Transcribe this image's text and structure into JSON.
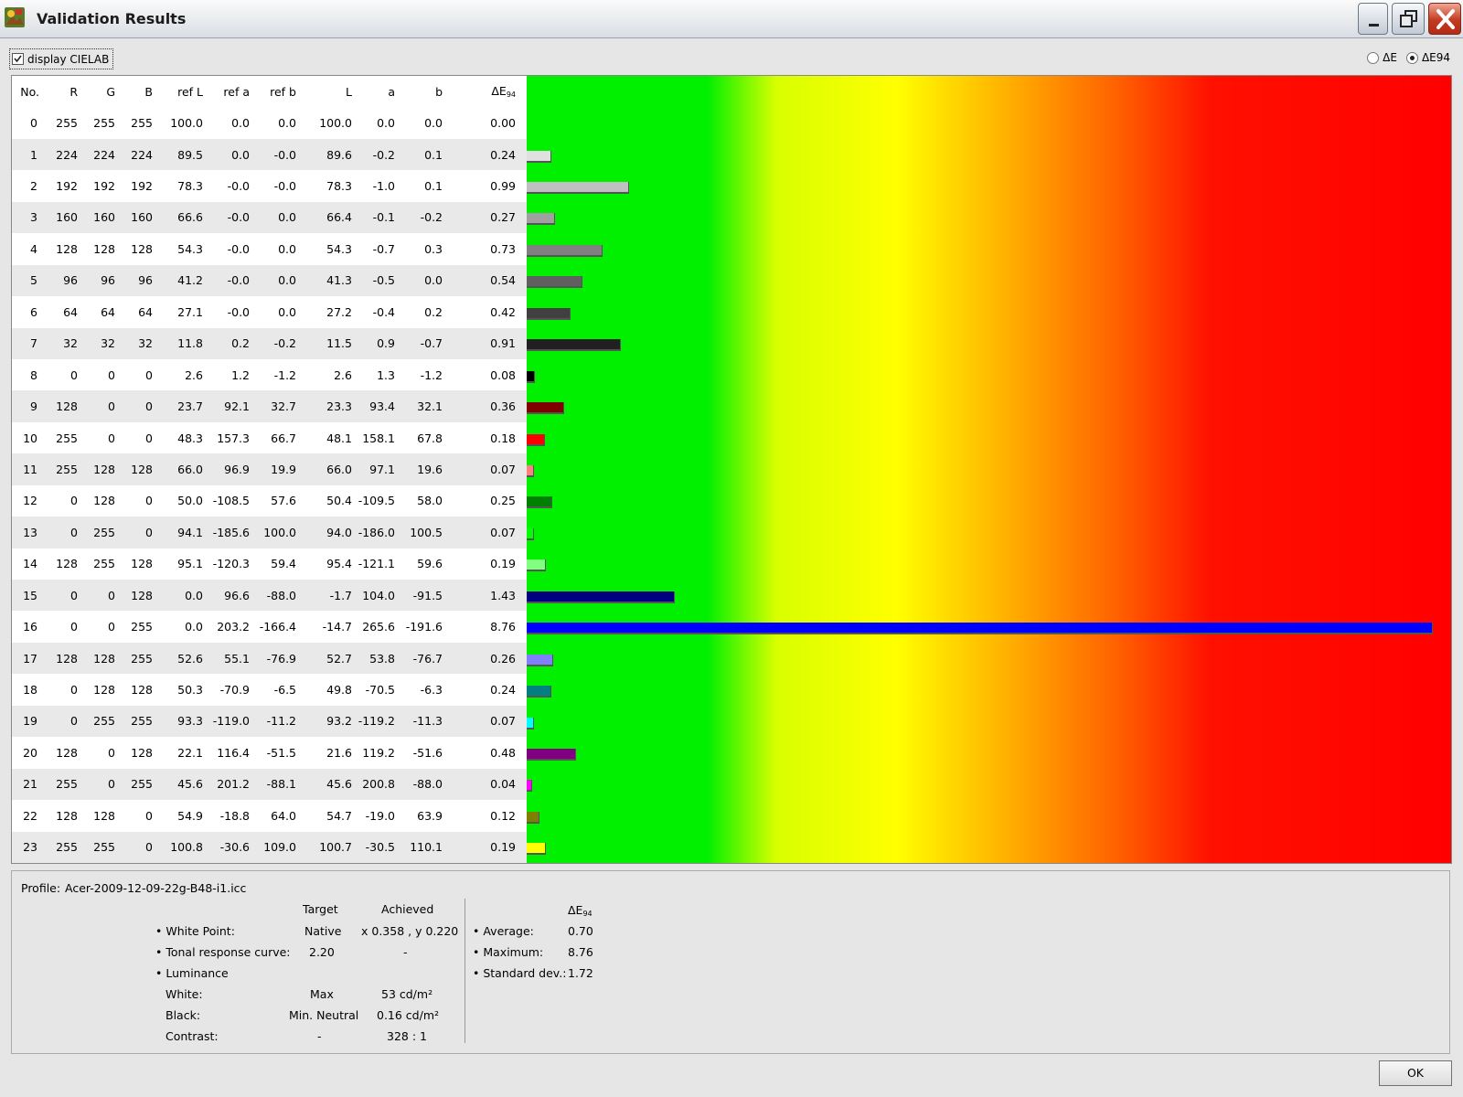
{
  "window": {
    "title": "Validation Results"
  },
  "options": {
    "display_cielab_label": "display CIELAB",
    "display_cielab_checked": true,
    "radio_de_label": "ΔE",
    "radio_de94_label": "ΔE94",
    "radio_selected": "ΔE94"
  },
  "table": {
    "headers": [
      "No.",
      "R",
      "G",
      "B",
      "ref L",
      "ref a",
      "ref b",
      "L",
      "a",
      "b",
      "ΔE",
      "94"
    ],
    "max_delta_scale": 8.76,
    "rows": [
      {
        "no": "0",
        "r": "255",
        "g": "255",
        "b": "255",
        "refL": "100.0",
        "refa": "0.0",
        "refb": "0.0",
        "L": "100.0",
        "a": "0.0",
        "bb": "0.0",
        "de": "0.00",
        "color": "#ffffff",
        "value": 0.0
      },
      {
        "no": "1",
        "r": "224",
        "g": "224",
        "b": "224",
        "refL": "89.5",
        "refa": "0.0",
        "refb": "-0.0",
        "L": "89.6",
        "a": "-0.2",
        "bb": "0.1",
        "de": "0.24",
        "color": "#e0e0e0",
        "value": 0.24
      },
      {
        "no": "2",
        "r": "192",
        "g": "192",
        "b": "192",
        "refL": "78.3",
        "refa": "-0.0",
        "refb": "-0.0",
        "L": "78.3",
        "a": "-1.0",
        "bb": "0.1",
        "de": "0.99",
        "color": "#c0c0c0",
        "value": 0.99
      },
      {
        "no": "3",
        "r": "160",
        "g": "160",
        "b": "160",
        "refL": "66.6",
        "refa": "-0.0",
        "refb": "0.0",
        "L": "66.4",
        "a": "-0.1",
        "bb": "-0.2",
        "de": "0.27",
        "color": "#a0a0a0",
        "value": 0.27
      },
      {
        "no": "4",
        "r": "128",
        "g": "128",
        "b": "128",
        "refL": "54.3",
        "refa": "-0.0",
        "refb": "0.0",
        "L": "54.3",
        "a": "-0.7",
        "bb": "0.3",
        "de": "0.73",
        "color": "#808080",
        "value": 0.73
      },
      {
        "no": "5",
        "r": "96",
        "g": "96",
        "b": "96",
        "refL": "41.2",
        "refa": "-0.0",
        "refb": "0.0",
        "L": "41.3",
        "a": "-0.5",
        "bb": "0.0",
        "de": "0.54",
        "color": "#606060",
        "value": 0.54
      },
      {
        "no": "6",
        "r": "64",
        "g": "64",
        "b": "64",
        "refL": "27.1",
        "refa": "-0.0",
        "refb": "0.0",
        "L": "27.2",
        "a": "-0.4",
        "bb": "0.2",
        "de": "0.42",
        "color": "#404040",
        "value": 0.42
      },
      {
        "no": "7",
        "r": "32",
        "g": "32",
        "b": "32",
        "refL": "11.8",
        "refa": "0.2",
        "refb": "-0.2",
        "L": "11.5",
        "a": "0.9",
        "bb": "-0.7",
        "de": "0.91",
        "color": "#202020",
        "value": 0.91
      },
      {
        "no": "8",
        "r": "0",
        "g": "0",
        "b": "0",
        "refL": "2.6",
        "refa": "1.2",
        "refb": "-1.2",
        "L": "2.6",
        "a": "1.3",
        "bb": "-1.2",
        "de": "0.08",
        "color": "#000000",
        "value": 0.08
      },
      {
        "no": "9",
        "r": "128",
        "g": "0",
        "b": "0",
        "refL": "23.7",
        "refa": "92.1",
        "refb": "32.7",
        "L": "23.3",
        "a": "93.4",
        "bb": "32.1",
        "de": "0.36",
        "color": "#800000",
        "value": 0.36
      },
      {
        "no": "10",
        "r": "255",
        "g": "0",
        "b": "0",
        "refL": "48.3",
        "refa": "157.3",
        "refb": "66.7",
        "L": "48.1",
        "a": "158.1",
        "bb": "67.8",
        "de": "0.18",
        "color": "#ff0000",
        "value": 0.18
      },
      {
        "no": "11",
        "r": "255",
        "g": "128",
        "b": "128",
        "refL": "66.0",
        "refa": "96.9",
        "refb": "19.9",
        "L": "66.0",
        "a": "97.1",
        "bb": "19.6",
        "de": "0.07",
        "color": "#ff8080",
        "value": 0.07
      },
      {
        "no": "12",
        "r": "0",
        "g": "128",
        "b": "0",
        "refL": "50.0",
        "refa": "-108.5",
        "refb": "57.6",
        "L": "50.4",
        "a": "-109.5",
        "bb": "58.0",
        "de": "0.25",
        "color": "#008000",
        "value": 0.25
      },
      {
        "no": "13",
        "r": "0",
        "g": "255",
        "b": "0",
        "refL": "94.1",
        "refa": "-185.6",
        "refb": "100.0",
        "L": "94.0",
        "a": "-186.0",
        "bb": "100.5",
        "de": "0.07",
        "color": "#00ff00",
        "value": 0.07
      },
      {
        "no": "14",
        "r": "128",
        "g": "255",
        "b": "128",
        "refL": "95.1",
        "refa": "-120.3",
        "refb": "59.4",
        "L": "95.4",
        "a": "-121.1",
        "bb": "59.6",
        "de": "0.19",
        "color": "#80ff80",
        "value": 0.19
      },
      {
        "no": "15",
        "r": "0",
        "g": "0",
        "b": "128",
        "refL": "0.0",
        "refa": "96.6",
        "refb": "-88.0",
        "L": "-1.7",
        "a": "104.0",
        "bb": "-91.5",
        "de": "1.43",
        "color": "#000080",
        "value": 1.43
      },
      {
        "no": "16",
        "r": "0",
        "g": "0",
        "b": "255",
        "refL": "0.0",
        "refa": "203.2",
        "refb": "-166.4",
        "L": "-14.7",
        "a": "265.6",
        "bb": "-191.6",
        "de": "8.76",
        "color": "#0000ff",
        "value": 8.76
      },
      {
        "no": "17",
        "r": "128",
        "g": "128",
        "b": "255",
        "refL": "52.6",
        "refa": "55.1",
        "refb": "-76.9",
        "L": "52.7",
        "a": "53.8",
        "bb": "-76.7",
        "de": "0.26",
        "color": "#8080ff",
        "value": 0.26
      },
      {
        "no": "18",
        "r": "0",
        "g": "128",
        "b": "128",
        "refL": "50.3",
        "refa": "-70.9",
        "refb": "-6.5",
        "L": "49.8",
        "a": "-70.5",
        "bb": "-6.3",
        "de": "0.24",
        "color": "#008080",
        "value": 0.24
      },
      {
        "no": "19",
        "r": "0",
        "g": "255",
        "b": "255",
        "refL": "93.3",
        "refa": "-119.0",
        "refb": "-11.2",
        "L": "93.2",
        "a": "-119.2",
        "bb": "-11.3",
        "de": "0.07",
        "color": "#00ffff",
        "value": 0.07
      },
      {
        "no": "20",
        "r": "128",
        "g": "0",
        "b": "128",
        "refL": "22.1",
        "refa": "116.4",
        "refb": "-51.5",
        "L": "21.6",
        "a": "119.2",
        "bb": "-51.6",
        "de": "0.48",
        "color": "#800080",
        "value": 0.48
      },
      {
        "no": "21",
        "r": "255",
        "g": "0",
        "b": "255",
        "refL": "45.6",
        "refa": "201.2",
        "refb": "-88.1",
        "L": "45.6",
        "a": "200.8",
        "bb": "-88.0",
        "de": "0.04",
        "color": "#ff00ff",
        "value": 0.04
      },
      {
        "no": "22",
        "r": "128",
        "g": "128",
        "b": "0",
        "refL": "54.9",
        "refa": "-18.8",
        "refb": "64.0",
        "L": "54.7",
        "a": "-19.0",
        "bb": "63.9",
        "de": "0.12",
        "color": "#808000",
        "value": 0.12
      },
      {
        "no": "23",
        "r": "255",
        "g": "255",
        "b": "0",
        "refL": "100.8",
        "refa": "-30.6",
        "refb": "109.0",
        "L": "100.7",
        "a": "-30.5",
        "bb": "110.1",
        "de": "0.19",
        "color": "#ffff00",
        "value": 0.19
      }
    ]
  },
  "summary": {
    "profile_label": "Profile:",
    "profile_value": "Acer-2009-12-09-22g-B48-i1.icc",
    "col_target": "Target",
    "col_achieved": "Achieved",
    "white_point_label": "• White Point:",
    "white_point_target": "Native",
    "white_point_achieved": "x 0.358 , y 0.220",
    "trc_label": "• Tonal response curve:",
    "trc_target": "2.20",
    "trc_achieved": "-",
    "luminance_label": "• Luminance",
    "white_label": "White:",
    "white_target": "Max",
    "white_achieved": "53 cd/m²",
    "black_label": "Black:",
    "black_target": "Min. Neutral",
    "black_achieved": "0.16 cd/m²",
    "contrast_label": "Contrast:",
    "contrast_target": "-",
    "contrast_achieved": "328 : 1",
    "de_header": "ΔE",
    "de_header_sub": "94",
    "average_label": "• Average:",
    "average_value": "0.70",
    "maximum_label": "• Maximum:",
    "maximum_value": "8.76",
    "stddev_label": "• Standard dev.:",
    "stddev_value": "1.72"
  },
  "buttons": {
    "ok_label": "OK"
  }
}
